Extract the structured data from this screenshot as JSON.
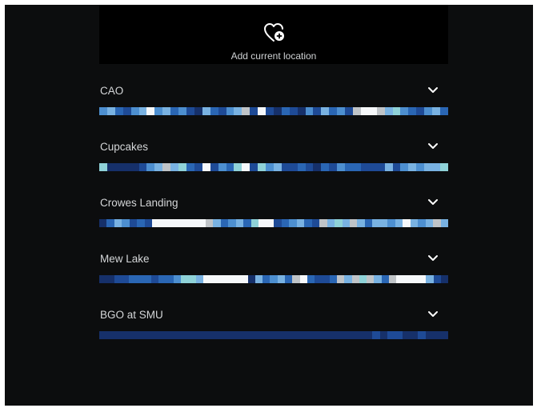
{
  "add_location": {
    "label": "Add current location",
    "icon": "heart-plus-icon"
  },
  "colors": {
    "background": "#0c0d0e",
    "panel": "#000000",
    "text": "#d4d6d8",
    "palette": {
      "n": "#16306a",
      "d": "#1e4a96",
      "m": "#2a66b4",
      "l": "#4d8fd0",
      "s": "#79b2e2",
      "t": "#8fd2d8",
      "g": "#c0c4c8",
      "w": "#f6f8fa"
    }
  },
  "locations": [
    {
      "name": "CAO",
      "strip": "lsmdlswlsmldnsmdlsgdwdnmdnldsmldgwwgstlmdlsm"
    },
    {
      "name": "Cupcakes",
      "strip": "tnnnndlsgstmdwdlmtwdtlsddmdnmdlmmdddsdlslsst"
    },
    {
      "name": "Crowes Landing",
      "strip": "nmsldmdwwwwwwwgsmlsmtwwdmlsmdgstsgsmsslswslsgs"
    },
    {
      "name": "Mew Lake",
      "strip": "nnddmmmdmmlttswwwwwwnsmlsmgwmddmgsgtgsmgwwwwsdn"
    },
    {
      "name": "BGO at SMU",
      "strip": "nnnnnnnnnnnnnnnnnnnnnnnnnnnnnnnnnnnndnddnndnnn"
    }
  ]
}
